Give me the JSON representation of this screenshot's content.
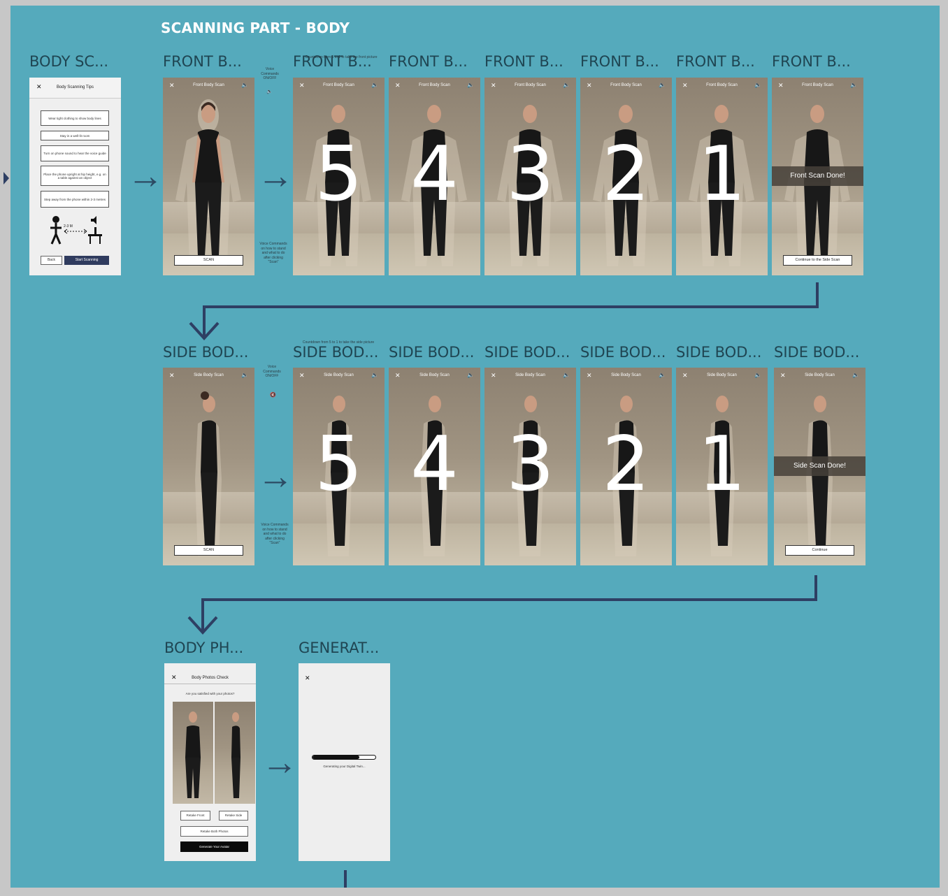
{
  "section_title": "SCANNING PART - BODY",
  "frame_labels": {
    "tips": "BODY SC...",
    "front": [
      "FRONT B...",
      "FRONT B...",
      "FRONT B...",
      "FRONT B...",
      "FRONT B...",
      "FRONT B...",
      "FRONT B..."
    ],
    "side": [
      "SIDE BOD...",
      "SIDE BOD...",
      "SIDE BOD...",
      "SIDE BOD...",
      "SIDE BOD...",
      "SIDE BOD...",
      "SIDE BOD..."
    ],
    "check": "BODY PH...",
    "generate": "GENERAT..."
  },
  "tips_screen": {
    "close": "✕",
    "title": "Body Scanning Tips",
    "tips": [
      "Wear tight clothing to show body lines",
      "Stay in a well-lit room",
      "Turn on phone sound to hear the voice guide",
      "Place the phone upright at hip height, e.g. on a table against an object",
      "Step away from the phone within 2-3 metres"
    ],
    "distance_label": "2-3 M",
    "back_button": "Back",
    "start_button": "Start Scanning"
  },
  "front_scan": {
    "header": "Front Body Scan",
    "scan_button": "SCAN",
    "countdown": [
      "5",
      "4",
      "3",
      "2",
      "1"
    ],
    "done_text": "Front Scan Done!",
    "continue_button": "Continue to the Side Scan",
    "note_voice_toggle": "Voice Commands ON/OFF",
    "note_voice_guide": "Voice Commands on how to stand and what to do after clicking \"Scan\"",
    "note_countdown": "Countdown from 5 to 1 to take the front picture"
  },
  "side_scan": {
    "header": "Side Body Scan",
    "scan_button": "SCAN",
    "countdown": [
      "5",
      "4",
      "3",
      "2",
      "1"
    ],
    "done_text": "Side Scan Done!",
    "continue_button": "Continue",
    "note_voice_toggle": "Voice Commands ON/OFF",
    "note_voice_guide": "Voice Commands on how to stand and what to do after clicking \"Scan\"",
    "note_countdown": "Countdown from 5 to 1 to take the side picture"
  },
  "check_screen": {
    "close": "✕",
    "title": "Body Photos Check",
    "question": "Are you satisfied with your photos?",
    "retake_front": "Retake Front",
    "retake_side": "Retake Side",
    "retake_both": "Retake Both Photos",
    "generate_button": "Generate Your Avatar"
  },
  "generate_screen": {
    "close": "✕",
    "progress": 0.74,
    "status": "Generating your Digital Twin..."
  },
  "icons": {
    "close": "close-icon",
    "speaker": "speaker-icon",
    "mute": "mute-icon",
    "arrow": "arrow-right-icon"
  },
  "colors": {
    "canvas": "#55aabc",
    "connector": "#2e3f63",
    "primary_button": "#2f3b5e"
  }
}
